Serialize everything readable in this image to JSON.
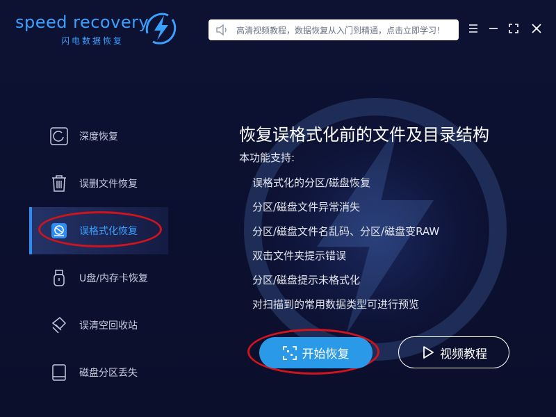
{
  "app": {
    "logo_text": "speed recovery",
    "logo_subtitle": "闪电数据恢复"
  },
  "notice": {
    "text": "高清视频教程，数据恢复从入门到精通，点击立即学习！"
  },
  "window_controls": [
    "menu-icon",
    "minimize-icon",
    "maximize-icon",
    "close-icon"
  ],
  "sidebar": {
    "items": [
      {
        "label": "深度恢复",
        "icon": "deep-scan-icon",
        "active": false
      },
      {
        "label": "误删文件恢复",
        "icon": "trash-icon",
        "active": false
      },
      {
        "label": "误格式化恢复",
        "icon": "format-disk-icon",
        "active": true
      },
      {
        "label": "U盘/内存卡恢复",
        "icon": "usb-icon",
        "active": false
      },
      {
        "label": "误清空回收站",
        "icon": "recycle-bin-icon",
        "active": false
      },
      {
        "label": "磁盘分区丢失",
        "icon": "disk-icon",
        "active": false
      }
    ]
  },
  "main": {
    "title": "恢复误格式化前的文件及目录结构",
    "support_label": "本功能支持:",
    "features": [
      "误格式化的分区/磁盘恢复",
      "分区/磁盘文件异常消失",
      "分区/磁盘文件名乱码、分区/磁盘变RAW",
      "双击文件夹提示错误",
      "分区/磁盘提示未格式化",
      "对扫描到的常用数据类型可进行预览"
    ],
    "start_button": "开始恢复",
    "video_button": "视频教程"
  },
  "colors": {
    "background": "#0b0f2c",
    "accent": "#2a9ae8",
    "annotation": "#d0141e"
  }
}
